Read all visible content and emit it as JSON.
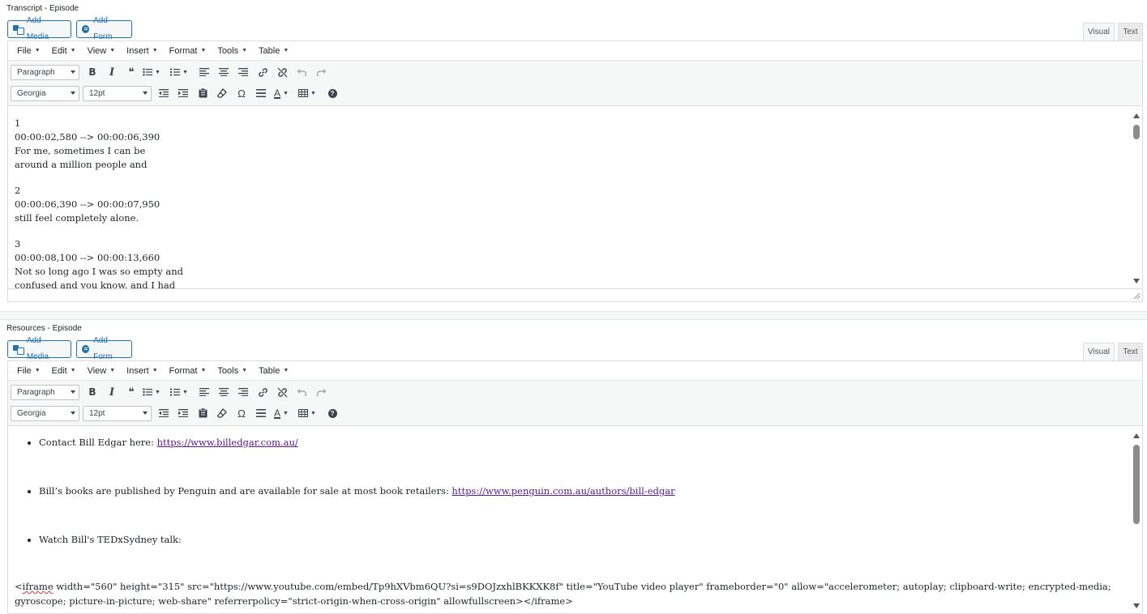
{
  "transcript": {
    "label": "Transcript - Episode",
    "add_media": "Add Media",
    "add_form": "Add Form",
    "tab_visual": "Visual",
    "tab_text": "Text",
    "menus": [
      "File",
      "Edit",
      "View",
      "Insert",
      "Format",
      "Tools",
      "Table"
    ],
    "block_format": "Paragraph",
    "font_family": "Georgia",
    "font_size": "12pt",
    "lines": [
      "1",
      "00:00:02,580 --> 00:00:06,390",
      "For me, sometimes I can be",
      "around a million people and",
      "",
      "2",
      "00:00:06,390 --> 00:00:07,950",
      "still feel completely alone.",
      "",
      "3",
      "00:00:08,100 --> 00:00:13,660",
      "Not so long ago I was so empty and",
      "confused and you know, and I had"
    ]
  },
  "resources": {
    "label": "Resources - Episode",
    "add_media": "Add Media",
    "add_form": "Add Form",
    "tab_visual": "Visual",
    "tab_text": "Text",
    "menus": [
      "File",
      "Edit",
      "View",
      "Insert",
      "Format",
      "Tools",
      "Table"
    ],
    "block_format": "Paragraph",
    "font_family": "Georgia",
    "font_size": "12pt",
    "items": [
      {
        "text": "Contact Bill Edgar here: ",
        "link": "https://www.billedgar.com.au/"
      },
      {
        "text": "Bill’s books are published by Penguin and are available for sale at most book retailers: ",
        "link": "https://www.penguin.com.au/authors/bill-edgar"
      },
      {
        "text": "Watch Bill's TEDxSydney talk:",
        "link": ""
      }
    ],
    "code_prefix": "<",
    "code_tag": "iframe",
    "code_rest": " width=\"560\" height=\"315\" src=\"https://www.youtube.com/embed/Tp9hXVbm6QU?si=s9DOJzxhlBKKXK8f\" title=\"YouTube video player\" frameborder=\"0\" allow=\"accelerometer; autoplay; clipboard-write; encrypted-media; gyroscope; picture-in-picture; web-share\" referrerpolicy=\"strict-origin-when-cross-origin\" allowfullscreen></iframe>"
  },
  "icons": {
    "bold": "B",
    "italic": "I",
    "blockquote": "❝",
    "help": "?",
    "omega": "Ω",
    "text_color": "A"
  },
  "colors": {
    "accent": "#2271b1",
    "link": "#551a8b",
    "toolbar_bg": "#f6f7f7"
  }
}
